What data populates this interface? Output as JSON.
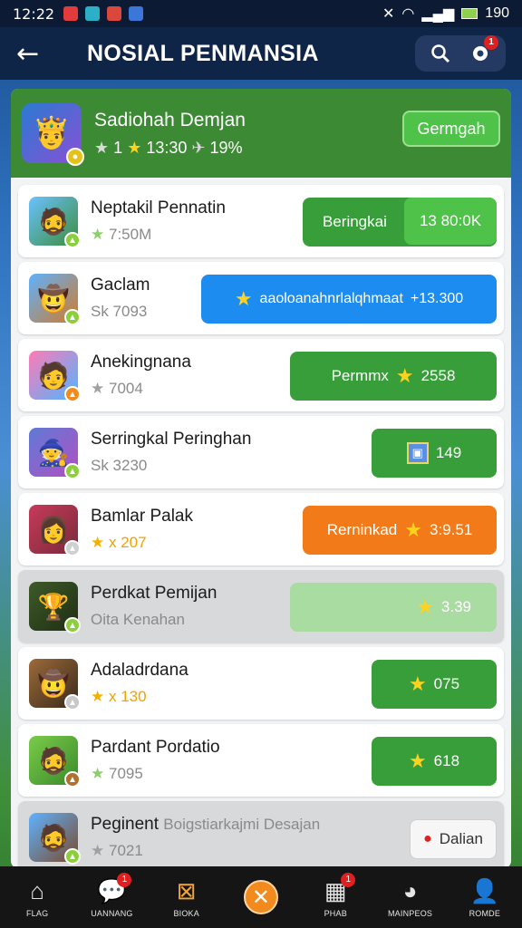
{
  "status_bar": {
    "time": "12:22",
    "battery": "190"
  },
  "top_bar": {
    "title": "NOSIAL PENMANSIA",
    "notification_count": "1"
  },
  "header": {
    "name": "Sadiohah Demjan",
    "stat1": "1",
    "stat2": "13:30",
    "stat3": "19%",
    "button_label": "Germgah"
  },
  "rows": [
    {
      "name": "Neptakil Pennatin",
      "sub": "7:50M",
      "action_label": "Beringkai",
      "action_value": "13 80:0K"
    },
    {
      "name": "Gaclam",
      "sub": "Sk 7093",
      "action_label": "aaoloanahnrlalqhmaat",
      "action_value": "+13.300"
    },
    {
      "name": "Anekingnana",
      "sub": "7004",
      "action_label": "Permmx",
      "action_value": "2558"
    },
    {
      "name": "Serringkal Peringhan",
      "sub": "Sk 3230",
      "action_label": "",
      "action_value": "149"
    },
    {
      "name": "Bamlar Palak",
      "sub": "x 207",
      "action_label": "Rerninkad",
      "action_value": "3:9.51"
    },
    {
      "name": "Perdkat Pemijan",
      "sub": "Oita Kenahan",
      "action_label": "",
      "action_value": "3.39"
    },
    {
      "name": "Adaladrdana",
      "sub": "x 130",
      "action_label": "",
      "action_value": "075"
    },
    {
      "name": "Pardant Pordatio",
      "sub": "7095",
      "action_label": "",
      "action_value": "618"
    },
    {
      "name": "Peginent",
      "name_extra": "Boigstiarkajmi Desajan",
      "sub": "7021",
      "action_label": "Dalian",
      "action_value": ""
    }
  ],
  "bottom_nav": [
    {
      "label": "FLAG",
      "icon": "home-icon"
    },
    {
      "label": "UANNANG",
      "icon": "chat-icon",
      "badge": "1"
    },
    {
      "label": "BIOKA",
      "icon": "crossed-box-icon"
    },
    {
      "label": "",
      "icon": "close-circle-icon"
    },
    {
      "label": "PHAB",
      "icon": "calendar-icon",
      "badge": "1"
    },
    {
      "label": "MAINPEOS",
      "icon": "palette-icon"
    },
    {
      "label": "ROMDE",
      "icon": "profile-icon"
    }
  ],
  "colors": {
    "green": "#389e3a",
    "orange": "#f27a18",
    "blue": "#1d8cf0",
    "header_green": "#3c8b34",
    "nav_bg": "#151515"
  }
}
